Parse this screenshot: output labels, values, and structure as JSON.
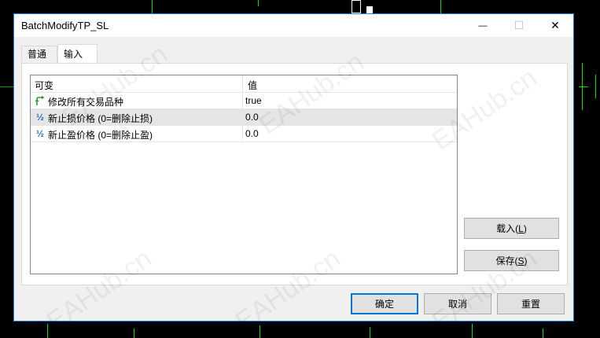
{
  "window": {
    "title": "BatchModifyTP_SL",
    "minimize_symbol": "—",
    "maximize_symbol": "☐",
    "close_symbol": "✕"
  },
  "tabs": [
    {
      "label": "普通",
      "active": false
    },
    {
      "label": "输入",
      "active": true
    }
  ],
  "grid": {
    "headers": {
      "variable": "可变",
      "value": "值"
    },
    "rows": [
      {
        "icon": "bool-arrow-icon",
        "name": "修改所有交易品种",
        "value": "true",
        "selected": false
      },
      {
        "icon": "half-icon",
        "icon_text": "½",
        "name": "新止损价格 (0=删除止损)",
        "value": "0.0",
        "selected": true
      },
      {
        "icon": "half-icon",
        "icon_text": "½",
        "name": "新止盈价格 (0=删除止盈)",
        "value": "0.0",
        "selected": false
      }
    ]
  },
  "side_buttons": {
    "load": {
      "text": "载入(",
      "key": "L",
      "end": ")"
    },
    "save": {
      "text": "保存(",
      "key": "S",
      "end": ")"
    }
  },
  "footer_buttons": {
    "ok": "确定",
    "cancel": "取消",
    "reset": "重置"
  },
  "watermark_text": "EAHub.cn",
  "colors": {
    "accent": "#0078d7",
    "chart_green": "#00e000"
  }
}
